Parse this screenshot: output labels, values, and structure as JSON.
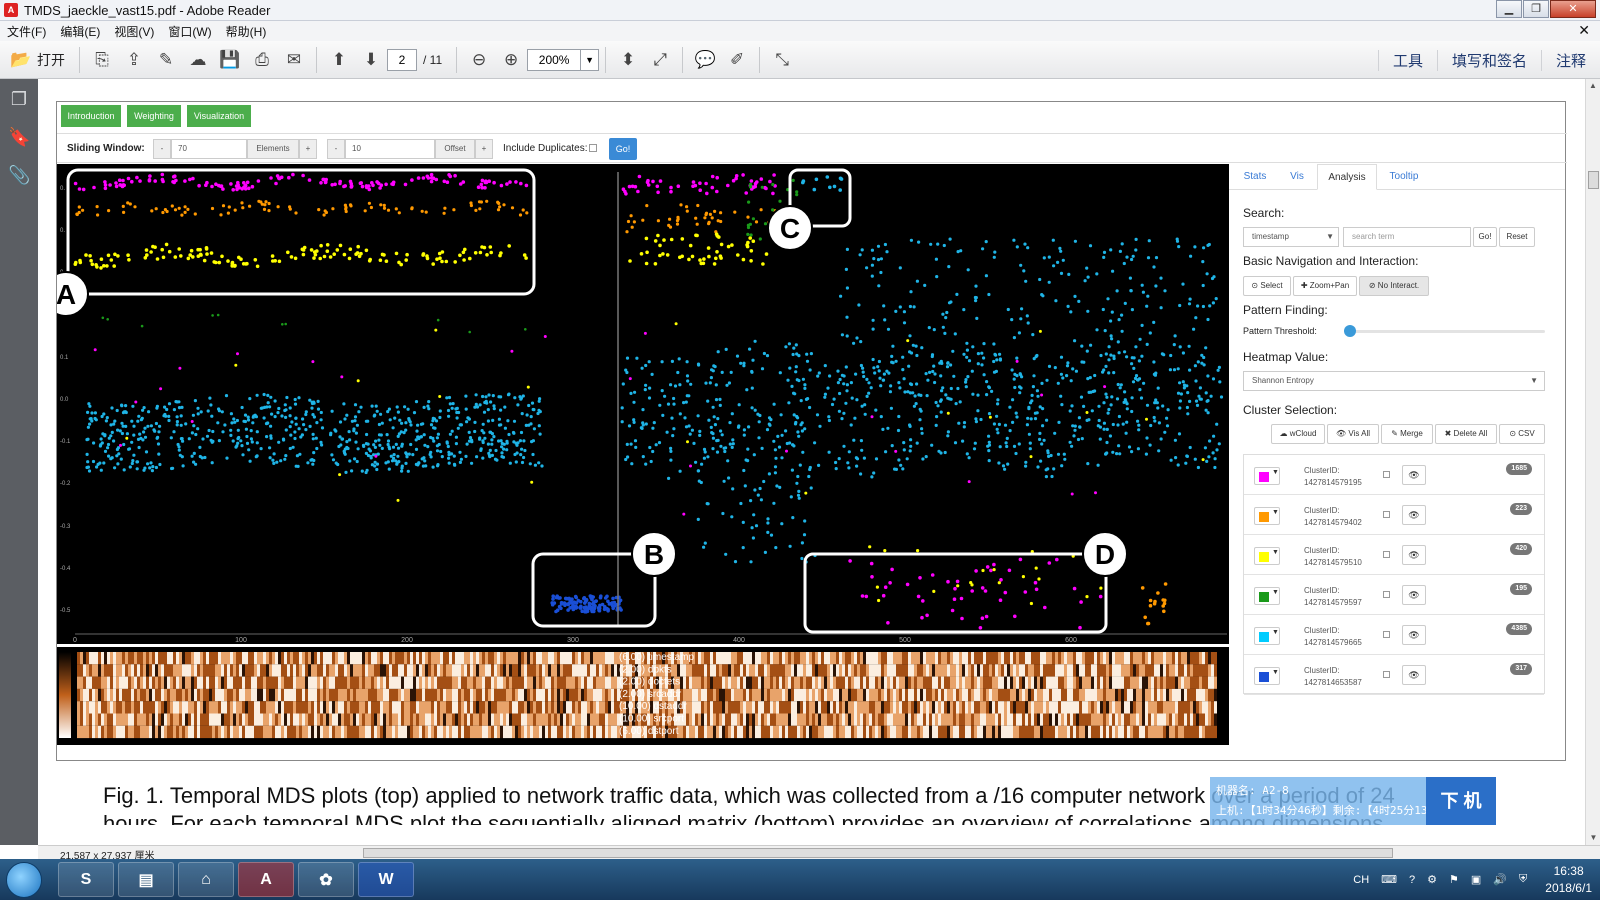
{
  "window": {
    "title": "TMDS_jaeckle_vast15.pdf - Adobe Reader"
  },
  "menu": [
    "文件(F)",
    "编辑(E)",
    "视图(V)",
    "窗口(W)",
    "帮助(H)"
  ],
  "toolbar": {
    "open_label": "打开",
    "page_current": "2",
    "page_total": "/ 11",
    "zoom": "200%",
    "right": [
      "工具",
      "填写和签名",
      "注释"
    ]
  },
  "vis": {
    "tabs": [
      "Introduction",
      "Weighting",
      "Visualization"
    ],
    "sliding_window_label": "Sliding Window:",
    "elements_value": "70",
    "elements_label": "Elements",
    "offset_value": "10",
    "offset_label": "Offset",
    "minus": "-",
    "plus": "+",
    "include_dup_label": "Include Duplicates:",
    "go_label": "Go!",
    "callouts": [
      "A",
      "B",
      "C",
      "D"
    ],
    "x_ticks": [
      "0",
      "100",
      "200",
      "300",
      "400",
      "500",
      "600"
    ],
    "y_ticks": [
      "0.",
      "0.",
      "0.",
      "0.1",
      "0.0",
      "-0.1",
      "-0.2",
      "-0.3",
      "-0.4",
      "-0.5"
    ],
    "heatmap_labels": [
      "(6.00) timestamp",
      "(2.00) dpkts",
      "(2.00) doctets",
      "(2.00) srcaddr",
      "(10.00) dstaddr",
      "(10.00) srcport",
      "(6.00) dstport"
    ]
  },
  "panel": {
    "tabs": [
      "Stats",
      "Vis",
      "Analysis",
      "Tooltip"
    ],
    "search_label": "Search:",
    "search_field": "timestamp",
    "search_placeholder": "search term",
    "search_go": "Go!",
    "search_reset": "Reset",
    "nav_label": "Basic Navigation and Interaction:",
    "nav_buttons": [
      "⊙ Select",
      "✚ Zoom+Pan",
      "⊘ No Interact."
    ],
    "pattern_label": "Pattern Finding:",
    "threshold_label": "Pattern Threshold:",
    "threshold_level": 0.0,
    "heatmap_label": "Heatmap Value:",
    "heatmap_value": "Shannon Entropy",
    "cluster_label": "Cluster Selection:",
    "cluster_buttons": [
      "☁ wCloud",
      "👁 Vis All",
      "✎ Merge",
      "✖ Delete All",
      "⊙ CSV"
    ],
    "cluster_id_label": "ClusterID:",
    "clusters": [
      {
        "id": "1427814579195",
        "count": "1685",
        "color": "#ff00ff"
      },
      {
        "id": "1427814579402",
        "count": "223",
        "color": "#ff9900"
      },
      {
        "id": "1427814579510",
        "count": "420",
        "color": "#ffff00"
      },
      {
        "id": "1427814579597",
        "count": "195",
        "color": "#1a9a1a"
      },
      {
        "id": "1427814579665",
        "count": "4385",
        "color": "#00ccff"
      },
      {
        "id": "1427814653587",
        "count": "317",
        "color": "#1a4fd6"
      }
    ]
  },
  "caption": {
    "line1": "Fig. 1.  Temporal MDS plots (top) applied to network traffic data, which was collected from a /16 computer network over a period of 24",
    "line2": "hours. For each temporal MDS plot the sequentially aligned matrix (bottom) provides an overview of correlations among dimensions."
  },
  "overlay": {
    "line1": "机器名: A2-8",
    "line2": "上机:【1时34分46秒】剩余:【4时25分13秒】",
    "button": "下 机"
  },
  "status": {
    "page_size": "21.587 x 27.937 厘米"
  },
  "taskbar": {
    "lang": "CH",
    "time": "16:38",
    "date": "2018/6/1"
  }
}
